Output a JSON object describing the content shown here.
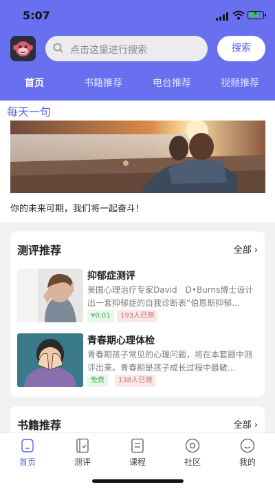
{
  "status": {
    "time": "5:07"
  },
  "colors": {
    "accent": "#6870f0",
    "accent_text": "#5b63e8",
    "price_green": "#3fae5c",
    "count_red": "#d06a6a"
  },
  "header": {
    "logo_icon": "monkey-logo-icon",
    "search": {
      "placeholder": "点击这里进行搜索",
      "button": "搜索"
    },
    "tabs": [
      {
        "label": "首页",
        "active": true
      },
      {
        "label": "书籍推荐",
        "active": false
      },
      {
        "label": "电台推荐",
        "active": false
      },
      {
        "label": "视频推荐",
        "active": false
      }
    ]
  },
  "daily": {
    "title": "每天一句",
    "quote": "你的未来可期，我们将一起奋斗！"
  },
  "tests": {
    "title": "测评推荐",
    "all": "全部",
    "items": [
      {
        "title": "抑郁症测评",
        "desc": "美国心理治疗专家David　D•Burns博士设计出一套抑郁症的自我诊断表“伯恩斯抑郁...",
        "price": "¥0.01",
        "count": "193人已测"
      },
      {
        "title": "青春期心理体检",
        "desc": "青春期孩子常见的心理问题，将在本套题中测评出来。青春期是孩子成长过程中最敏...",
        "price": "免费",
        "count": "138人已测"
      }
    ]
  },
  "books": {
    "title": "书籍推荐",
    "all": "全部"
  },
  "bottom_nav": [
    {
      "label": "首页",
      "icon": "home-icon",
      "active": true
    },
    {
      "label": "测评",
      "icon": "test-icon",
      "active": false
    },
    {
      "label": "课程",
      "icon": "course-icon",
      "active": false
    },
    {
      "label": "社区",
      "icon": "community-icon",
      "active": false
    },
    {
      "label": "我的",
      "icon": "profile-icon",
      "active": false
    }
  ]
}
